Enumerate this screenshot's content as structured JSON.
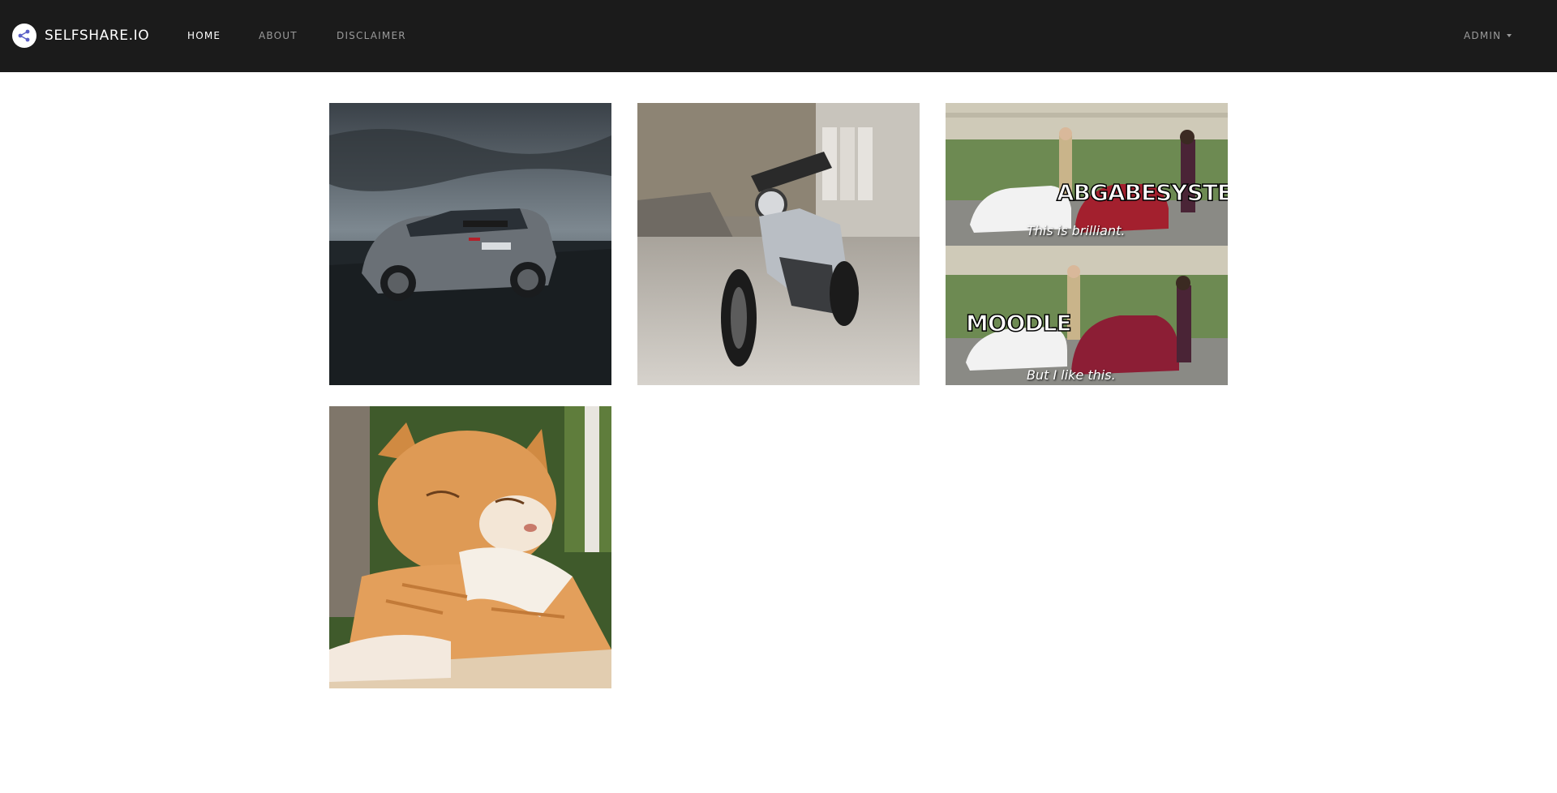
{
  "brand": {
    "name": "SELFSHARE.IO",
    "logo_icon": "share-icon"
  },
  "nav": {
    "home": "HOME",
    "about": "ABOUT",
    "disclaimer": "DISCLAIMER",
    "user_menu": "ADMIN"
  },
  "colors": {
    "navbar_bg": "#1b1b1b",
    "nav_active": "#ffffff",
    "nav_inactive": "#9a9a9a"
  },
  "gallery": {
    "meme": {
      "top_label": "ABGABESYSTEM",
      "top_caption": "This is brilliant.",
      "bottom_label": "MOODLE",
      "bottom_caption": "But I like this."
    }
  }
}
